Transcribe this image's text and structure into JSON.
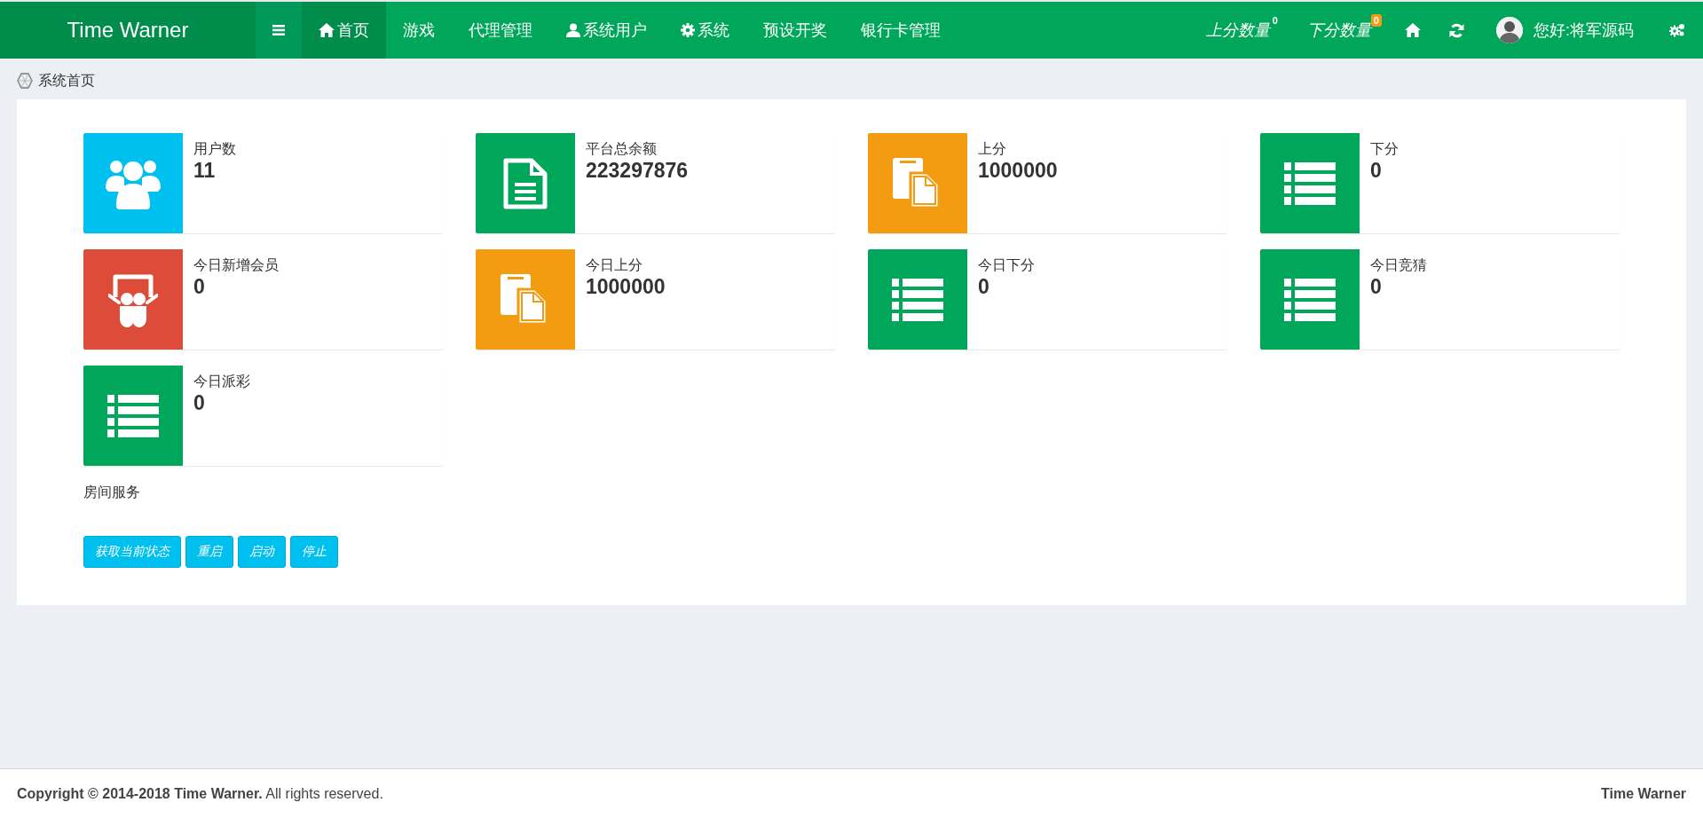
{
  "brand": "Time Warner",
  "nav": [
    {
      "label": "首页",
      "kind": "home",
      "selected": true
    },
    {
      "label": "游戏",
      "kind": "text",
      "selected": false
    },
    {
      "label": "代理管理",
      "kind": "text",
      "selected": false
    },
    {
      "label": "系统用户",
      "kind": "user",
      "selected": false
    },
    {
      "label": "系统",
      "kind": "gear",
      "selected": false
    },
    {
      "label": "预设开奖",
      "kind": "text",
      "selected": false
    },
    {
      "label": "银行卡管理",
      "kind": "text",
      "selected": false
    }
  ],
  "counters": [
    {
      "label": "上分数量",
      "badge": "0",
      "kind": "plain"
    },
    {
      "label": "下分数量",
      "badge": "0",
      "kind": "filled"
    }
  ],
  "user": {
    "greeting": "您好:将军源码"
  },
  "breadcrumb": "系统首页",
  "cards": [
    {
      "label": "用户数",
      "value": "11",
      "kind": "users",
      "color": "#00c0ef"
    },
    {
      "label": "平台总余额",
      "value": "223297876",
      "kind": "file",
      "color": "#00a65a"
    },
    {
      "label": "上分",
      "value": "1000000",
      "kind": "copy",
      "color": "#f39c12"
    },
    {
      "label": "下分",
      "value": "0",
      "kind": "list",
      "color": "#00a65a"
    },
    {
      "label": "今日新增会员",
      "value": "0",
      "kind": "board",
      "color": "#dd4b39"
    },
    {
      "label": "今日上分",
      "value": "1000000",
      "kind": "copy",
      "color": "#f39c12"
    },
    {
      "label": "今日下分",
      "value": "0",
      "kind": "list",
      "color": "#00a65a"
    },
    {
      "label": "今日竞猜",
      "value": "0",
      "kind": "list",
      "color": "#00a65a"
    },
    {
      "label": "今日派彩",
      "value": "0",
      "kind": "list",
      "color": "#00a65a"
    }
  ],
  "room": {
    "title": "房间服务",
    "buttons": [
      "获取当前状态",
      "重启",
      "启动",
      "停止"
    ]
  },
  "footer": {
    "copyright": "**Copyright © 2014-2018 Time Warner.** All rights reserved.",
    "brand": "Time Warner"
  }
}
